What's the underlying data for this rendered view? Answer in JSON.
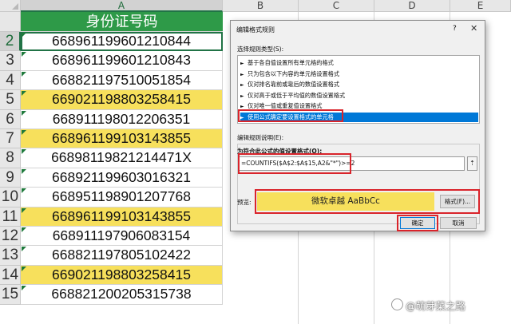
{
  "sheet": {
    "column_headers": [
      "A",
      "B",
      "C",
      "D",
      "E"
    ],
    "header_cell": "身份证号码",
    "rows": [
      {
        "num": "2",
        "value": "668961199601210844",
        "highlighted": false,
        "selected": true
      },
      {
        "num": "3",
        "value": "668961199601210843",
        "highlighted": false,
        "selected": false
      },
      {
        "num": "4",
        "value": "668821197510051854",
        "highlighted": false,
        "selected": false
      },
      {
        "num": "5",
        "value": "669021198803258415",
        "highlighted": true,
        "selected": false
      },
      {
        "num": "6",
        "value": "668911198012206351",
        "highlighted": false,
        "selected": false
      },
      {
        "num": "7",
        "value": "668961199103143855",
        "highlighted": true,
        "selected": false
      },
      {
        "num": "8",
        "value": "66898119821214471X",
        "highlighted": false,
        "selected": false
      },
      {
        "num": "9",
        "value": "668921199603016321",
        "highlighted": false,
        "selected": false
      },
      {
        "num": "10",
        "value": "668951198901207768",
        "highlighted": false,
        "selected": false
      },
      {
        "num": "11",
        "value": "668961199103143855",
        "highlighted": true,
        "selected": false
      },
      {
        "num": "12",
        "value": "668911197906083154",
        "highlighted": false,
        "selected": false
      },
      {
        "num": "13",
        "value": "668821197805102422",
        "highlighted": false,
        "selected": false
      },
      {
        "num": "14",
        "value": "669021198803258415",
        "highlighted": true,
        "selected": false
      },
      {
        "num": "15",
        "value": "668821200205315738",
        "highlighted": false,
        "selected": false
      }
    ],
    "colors": {
      "header_fill": "#2e9a48",
      "highlight_fill": "#f7e05c",
      "selection": "#217346"
    }
  },
  "dialog": {
    "title": "编辑格式规则",
    "help": "?",
    "close_icon": "close-icon",
    "select_type_label": "选择规则类型(S):",
    "rule_types": [
      "基于各自值设置所有单元格的格式",
      "只为包含以下内容的单元格设置格式",
      "仅对排名靠前或靠后的数值设置格式",
      "仅对高于或低于平均值的数值设置格式",
      "仅对唯一值或重复值设置格式",
      "使用公式确定要设置格式的单元格"
    ],
    "selected_rule_index": 5,
    "edit_desc_label": "编辑规则说明(E):",
    "formula_label": "为符合此公式的值设置格式(O):",
    "formula_value": "=COUNTIFS($A$2:$A$15,A2&\"*\")>=2",
    "preview_label": "预览:",
    "preview_text": "微软卓越  AaBbCc",
    "format_button": "格式(F)...",
    "ok_button": "确定",
    "cancel_button": "取消",
    "accent_color": "#d9242b"
  },
  "watermark": "@萌芽菜之路"
}
